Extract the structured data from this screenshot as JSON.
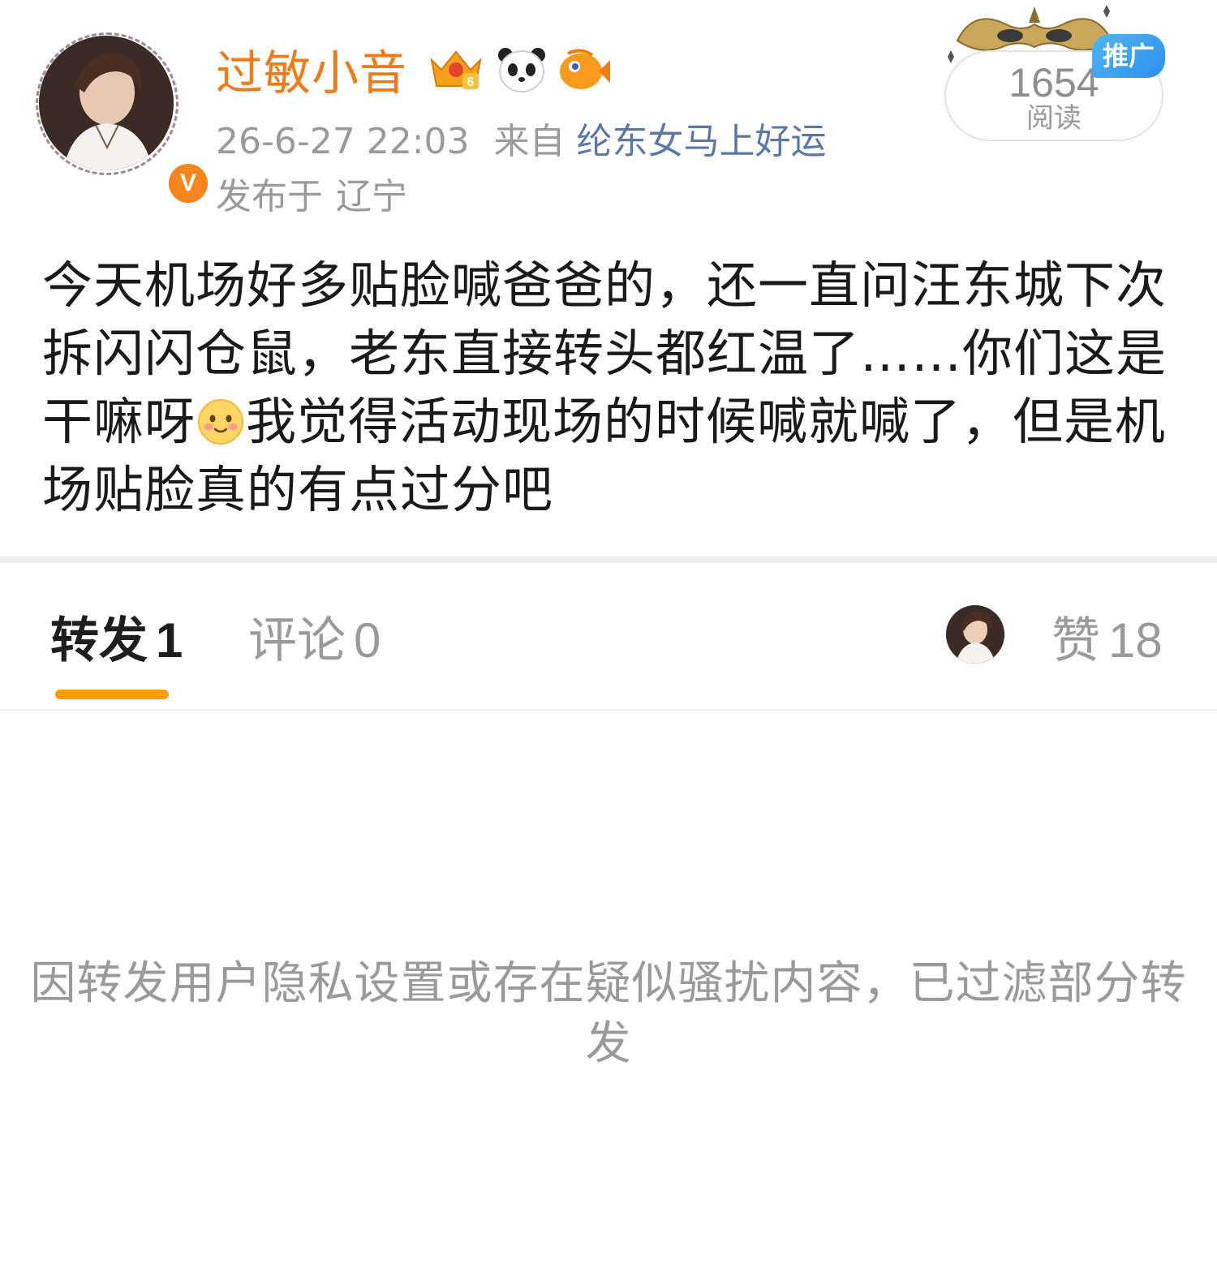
{
  "post": {
    "author": {
      "name": "过敏小音",
      "verified_mark": "V",
      "badges": [
        "crown-level-6-badge",
        "panda-badge",
        "fish-badge"
      ],
      "crown_level": "6"
    },
    "timestamp": "26-6-27 22:03",
    "source_prefix": "来自",
    "source": "纶东女马上好运",
    "location_prefix": "发布于",
    "location": "辽宁",
    "reads": {
      "count": "1654",
      "label": "阅读"
    },
    "promote_label": "推广",
    "body": {
      "before_emoji": "今天机场好多贴脸喊爸爸的，还一直问汪东城下次拆闪闪仓鼠，老东直接转头都红温了……你们这是干嘛呀",
      "emoji": "blush-emoji",
      "after_emoji": "我觉得活动现场的时候喊就喊了，但是机场贴脸真的有点过分吧"
    }
  },
  "tabs": {
    "repost": {
      "label": "转发",
      "count": "1"
    },
    "comment": {
      "label": "评论",
      "count": "0"
    },
    "like": {
      "label": "赞",
      "count": "18"
    }
  },
  "notice": "因转发用户隐私设置或存在疑似骚扰内容，已过滤部分转发",
  "colors": {
    "username": "#f07b16",
    "source_link": "#5b76a8",
    "tab_indicator": "#ff9d00",
    "promote_tag": "#2d8fe8",
    "muted_text": "#9a9a9a"
  }
}
